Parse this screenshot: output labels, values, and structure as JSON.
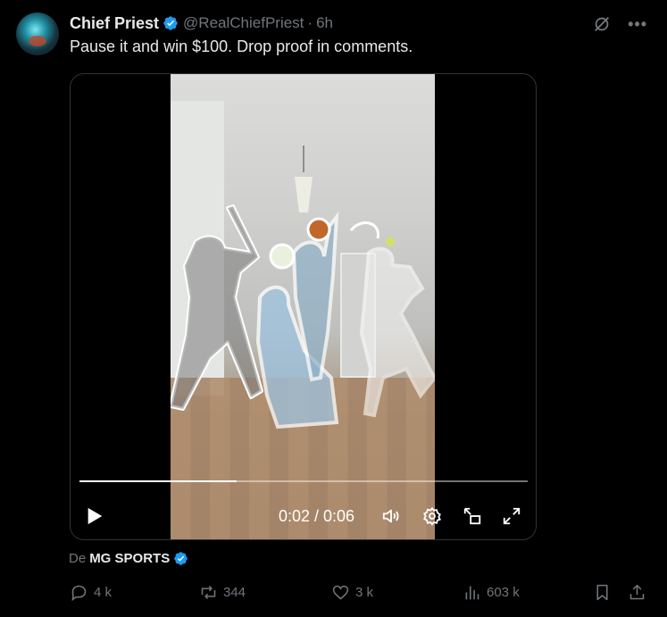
{
  "author": {
    "name": "Chief Priest",
    "handle": "@RealChiefPriest",
    "separator": "·",
    "time": "6h",
    "verified": true,
    "avatar_icon": "avatar-image"
  },
  "tweet": {
    "text": "Pause it and win $100. Drop proof in comments."
  },
  "video": {
    "current_time": "0:02",
    "duration": "0:06",
    "time_display": "0:02 / 0:06",
    "progress": 0.35,
    "controls": [
      "play-icon",
      "volume-icon",
      "settings-icon",
      "pip-icon",
      "fullscreen-icon"
    ]
  },
  "source": {
    "prefix": "De",
    "name": "MG SPORTS",
    "verified": true
  },
  "actions": {
    "replies": "4 k",
    "reposts": "344",
    "likes": "3 k",
    "views": "603 k"
  },
  "colors": {
    "background": "#000000",
    "text": "#e7e9ea",
    "muted": "#71767b",
    "verified": "#1d9bf0",
    "repost": "#71767b"
  }
}
